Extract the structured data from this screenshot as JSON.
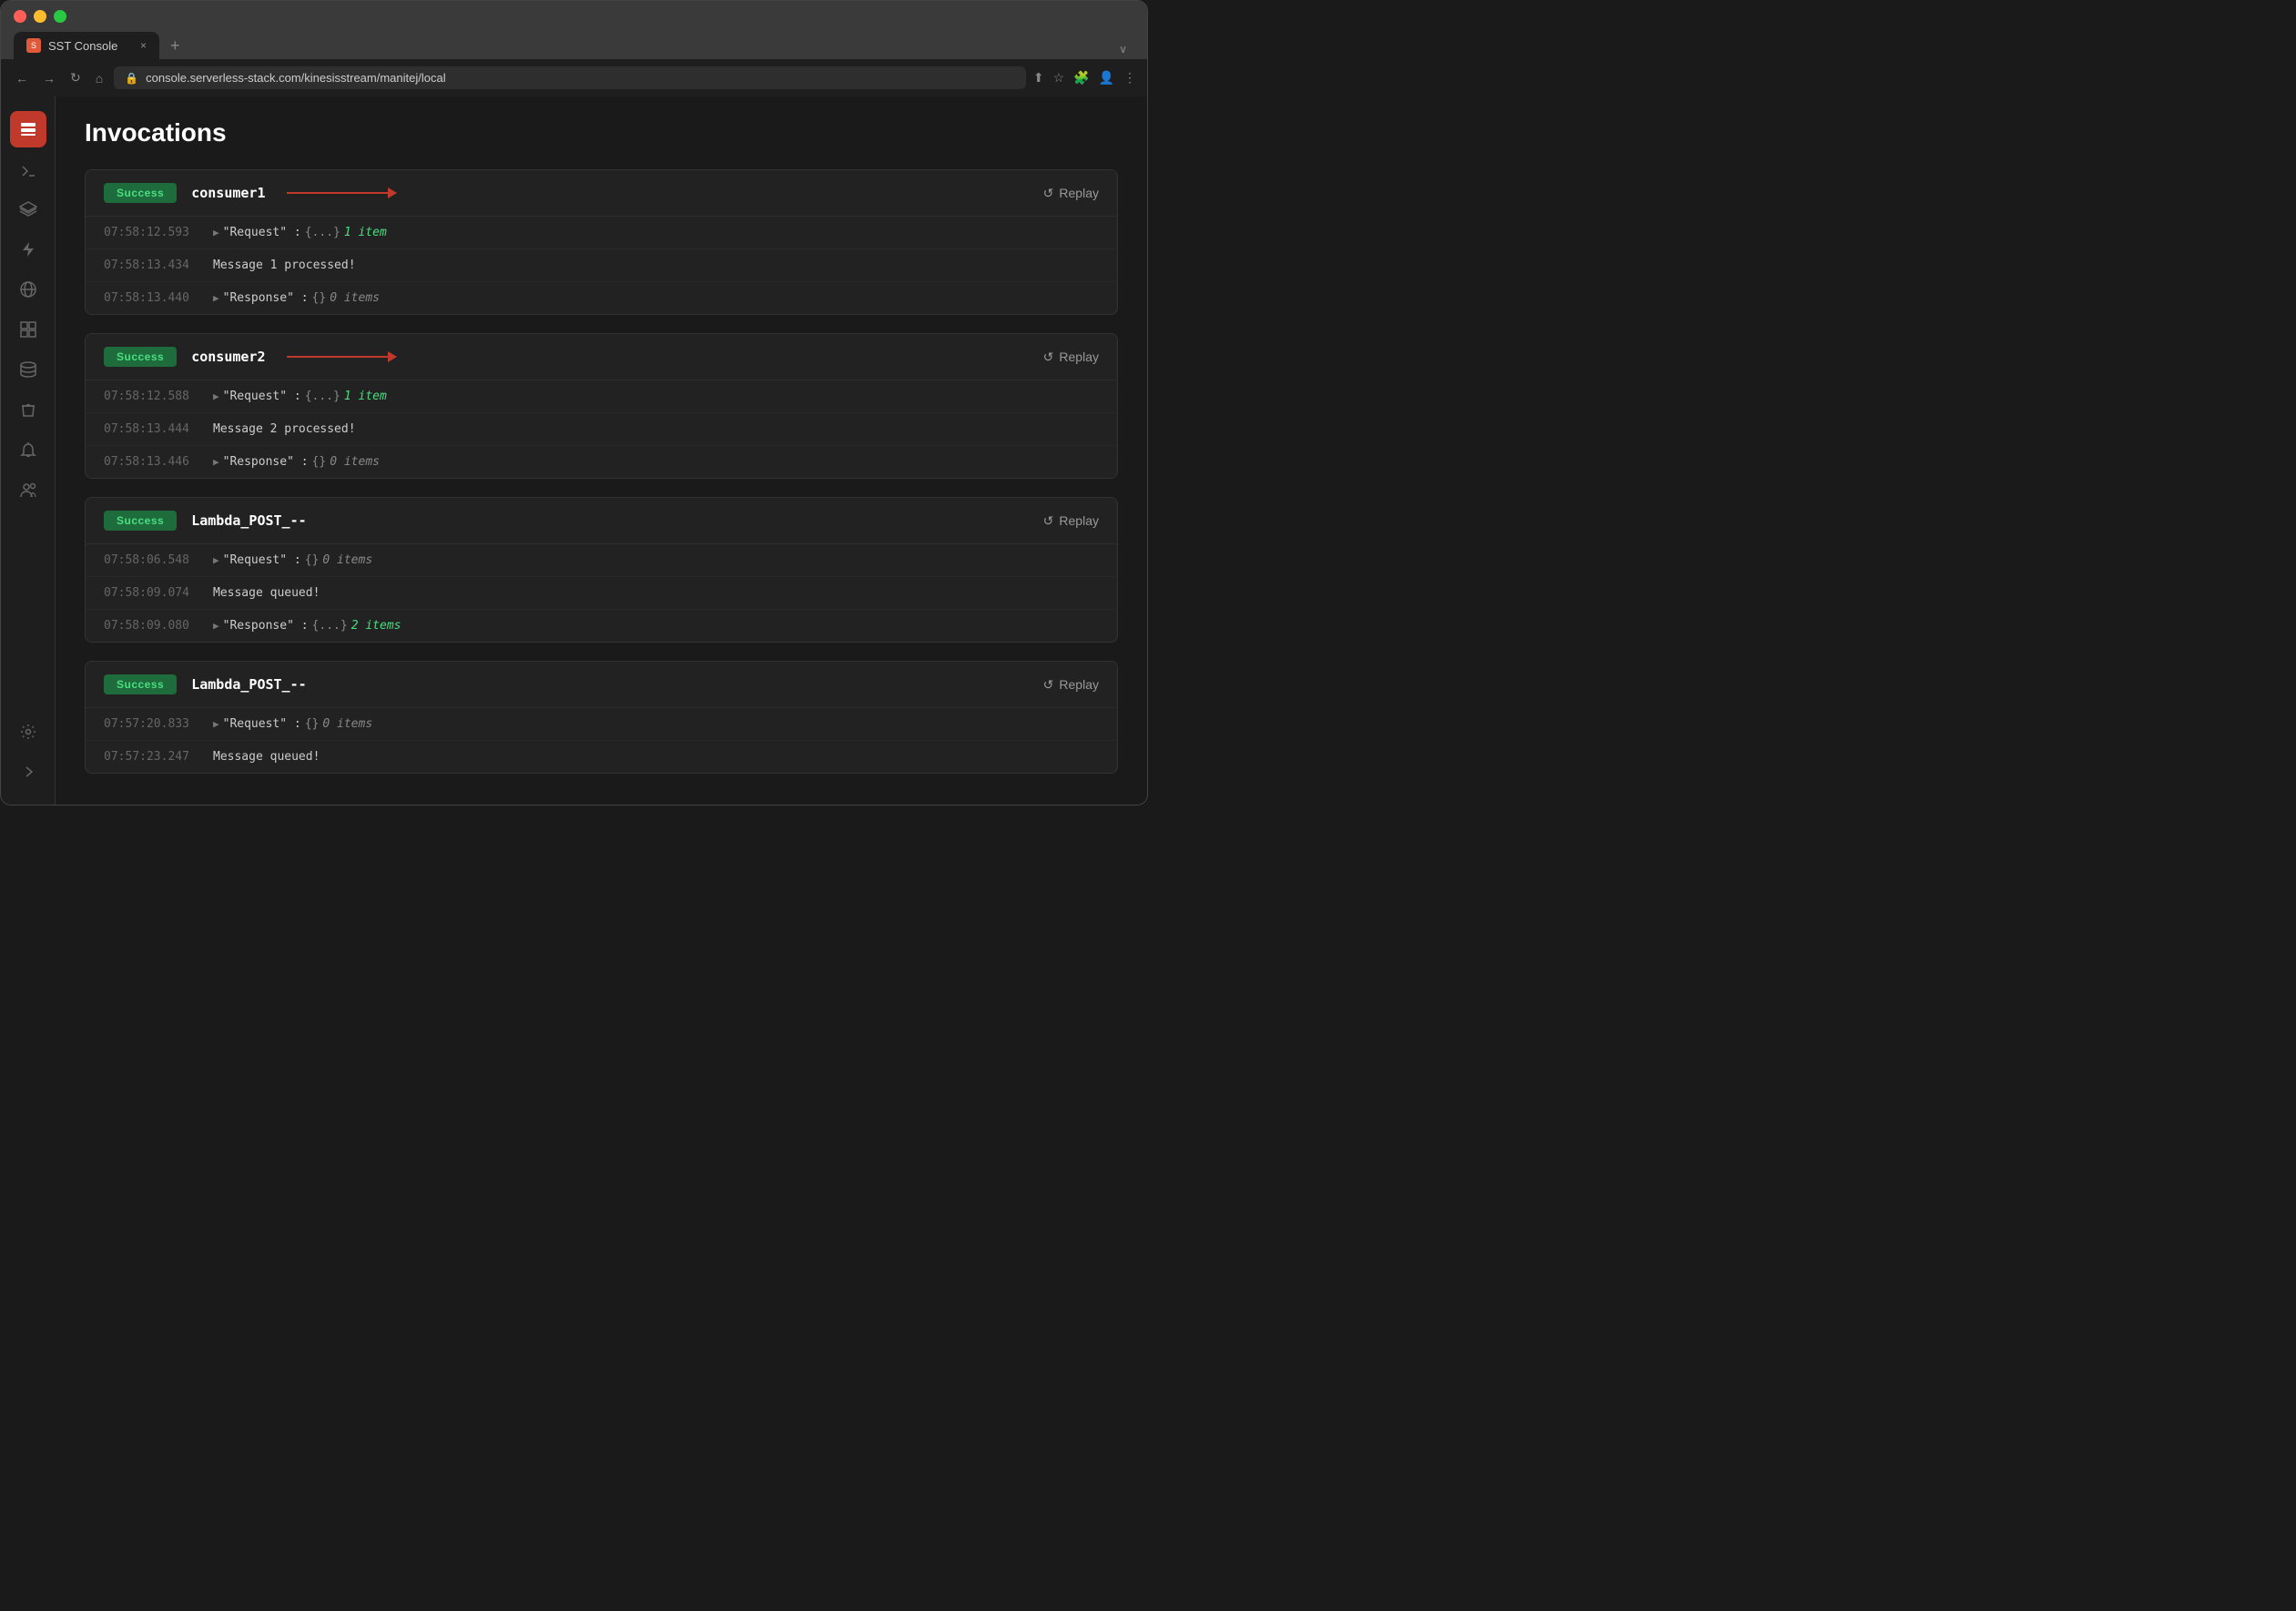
{
  "browser": {
    "tab_label": "SST Console",
    "tab_close": "×",
    "tab_add": "+",
    "address": "console.serverless-stack.com/kinesisstream/manitej/local",
    "nav_back": "←",
    "nav_forward": "→",
    "nav_reload": "↻",
    "nav_home": "⌂"
  },
  "sidebar": {
    "icons": [
      {
        "name": "server-icon",
        "symbol": "⬛",
        "active": true
      },
      {
        "name": "terminal-icon",
        "symbol": ">_",
        "active": false
      },
      {
        "name": "layers-icon",
        "symbol": "≡",
        "active": false
      },
      {
        "name": "lightning-icon",
        "symbol": "⚡",
        "active": false
      },
      {
        "name": "globe-icon",
        "symbol": "⊕",
        "active": false
      },
      {
        "name": "grid-icon",
        "symbol": "⊞",
        "active": false
      },
      {
        "name": "database-icon",
        "symbol": "◉",
        "active": false
      },
      {
        "name": "bucket-icon",
        "symbol": "⬡",
        "active": false
      },
      {
        "name": "bell-icon",
        "symbol": "🔔",
        "active": false
      },
      {
        "name": "users-icon",
        "symbol": "👥",
        "active": false
      }
    ],
    "bottom_icons": [
      {
        "name": "settings-icon",
        "symbol": "✦",
        "active": false
      },
      {
        "name": "expand-icon",
        "symbol": "→",
        "active": false
      }
    ]
  },
  "page": {
    "title": "Invocations",
    "replay_label": "Replay",
    "invocations": [
      {
        "id": "inv-1",
        "status": "Success",
        "consumer": "consumer1",
        "has_arrow": true,
        "logs": [
          {
            "time": "07:58:12.593",
            "type": "expand",
            "content": "\"Request\" : {...}",
            "items": "1 item"
          },
          {
            "time": "07:58:13.434",
            "type": "plain",
            "content": "Message 1 processed!"
          },
          {
            "time": "07:58:13.440",
            "type": "expand",
            "content": "\"Response\" : {}",
            "items": "0 items"
          }
        ]
      },
      {
        "id": "inv-2",
        "status": "Success",
        "consumer": "consumer2",
        "has_arrow": true,
        "logs": [
          {
            "time": "07:58:12.588",
            "type": "expand",
            "content": "\"Request\" : {...}",
            "items": "1 item"
          },
          {
            "time": "07:58:13.444",
            "type": "plain",
            "content": "Message 2 processed!"
          },
          {
            "time": "07:58:13.446",
            "type": "expand",
            "content": "\"Response\" : {}",
            "items": "0 items"
          }
        ]
      },
      {
        "id": "inv-3",
        "status": "Success",
        "consumer": "Lambda_POST_--",
        "has_arrow": false,
        "logs": [
          {
            "time": "07:58:06.548",
            "type": "expand",
            "content": "\"Request\" : {}",
            "items": "0 items"
          },
          {
            "time": "07:58:09.074",
            "type": "plain",
            "content": "Message queued!"
          },
          {
            "time": "07:58:09.080",
            "type": "expand",
            "content": "\"Response\" : {...}",
            "items": "2 items"
          }
        ]
      },
      {
        "id": "inv-4",
        "status": "Success",
        "consumer": "Lambda_POST_--",
        "has_arrow": false,
        "logs": [
          {
            "time": "07:57:20.833",
            "type": "expand",
            "content": "\"Request\" : {}",
            "items": "0 items"
          },
          {
            "time": "07:57:23.247",
            "type": "plain",
            "content": "Message queued!"
          }
        ]
      }
    ]
  }
}
